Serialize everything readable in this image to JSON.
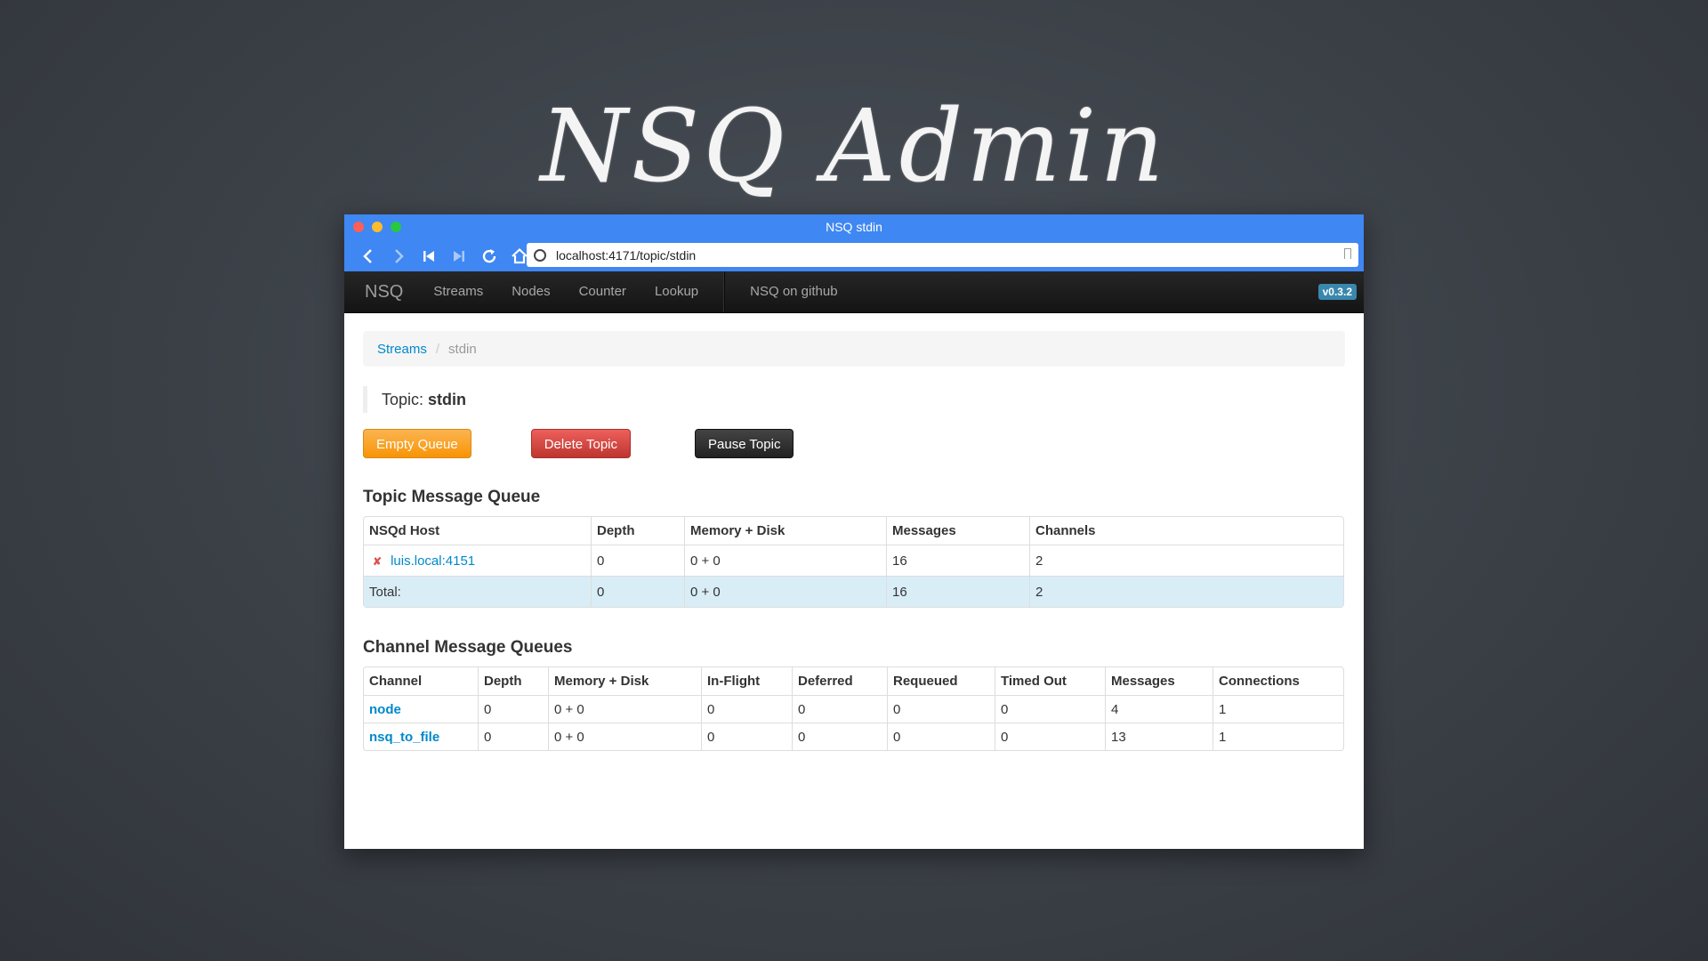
{
  "slide_title": "NSQ Admin",
  "window": {
    "title": "NSQ stdin"
  },
  "browser": {
    "url": "localhost:4171/topic/stdin"
  },
  "navbar": {
    "brand": "NSQ",
    "items": [
      "Streams",
      "Nodes",
      "Counter",
      "Lookup"
    ],
    "github": "NSQ on github",
    "version": "v0.3.2"
  },
  "breadcrumb": {
    "link": "Streams",
    "separator": "/",
    "active": "stdin"
  },
  "topic": {
    "prefix": "Topic:",
    "name": "stdin"
  },
  "buttons": {
    "empty": "Empty Queue",
    "delete": "Delete Topic",
    "pause": "Pause Topic"
  },
  "topic_queue": {
    "heading": "Topic Message Queue",
    "columns": [
      "NSQd Host",
      "Depth",
      "Memory + Disk",
      "Messages",
      "Channels"
    ],
    "row": {
      "host": "luis.local:4151",
      "depth": "0",
      "mem": "0 + 0",
      "messages": "16",
      "channels": "2"
    },
    "total": {
      "label": "Total:",
      "depth": "0",
      "mem": "0 + 0",
      "messages": "16",
      "channels": "2"
    }
  },
  "channel_queue": {
    "heading": "Channel Message Queues",
    "columns": [
      "Channel",
      "Depth",
      "Memory + Disk",
      "In-Flight",
      "Deferred",
      "Requeued",
      "Timed Out",
      "Messages",
      "Connections"
    ],
    "rows": [
      {
        "channel": "node",
        "depth": "0",
        "mem": "0 + 0",
        "inflight": "0",
        "deferred": "0",
        "requeued": "0",
        "timedout": "0",
        "messages": "4",
        "connections": "1"
      },
      {
        "channel": "nsq_to_file",
        "depth": "0",
        "mem": "0 + 0",
        "inflight": "0",
        "deferred": "0",
        "requeued": "0",
        "timedout": "0",
        "messages": "13",
        "connections": "1"
      }
    ]
  }
}
